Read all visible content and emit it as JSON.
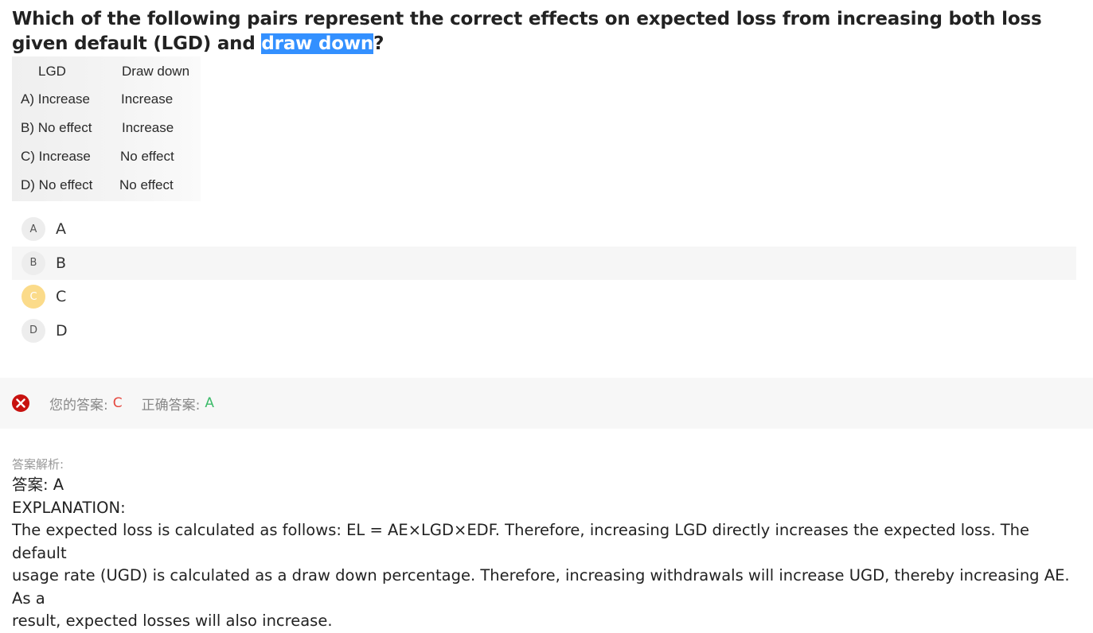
{
  "question": {
    "text_before": "Which of the following pairs represent the correct effects on expected loss from increasing both loss given default (LGD) and ",
    "highlight": "draw down",
    "text_after": "?"
  },
  "table": {
    "header": {
      "lgd": "LGD",
      "draw_down": "Draw down"
    },
    "rows": [
      {
        "lgd": "A) Increase",
        "draw_down": "Increase"
      },
      {
        "lgd": "B) No effect",
        "draw_down": "Increase"
      },
      {
        "lgd": "C) Increase",
        "draw_down": "No effect"
      },
      {
        "lgd": "D) No effect",
        "draw_down": "No effect"
      }
    ]
  },
  "options": [
    {
      "letter": "A",
      "label": "A"
    },
    {
      "letter": "B",
      "label": "B"
    },
    {
      "letter": "C",
      "label": "C"
    },
    {
      "letter": "D",
      "label": "D"
    }
  ],
  "result": {
    "your_answer_label": "您的答案:",
    "your_answer": "C",
    "correct_answer_label": "正确答案:",
    "correct_answer": "A"
  },
  "analysis": {
    "label": "答案解析:",
    "answer_line": "答案: A",
    "explanation_title": "EXPLANATION:",
    "explanation_lines": [
      "The expected loss is calculated as follows: EL = AE×LGD×EDF. Therefore, increasing LGD directly increases the expected loss. The default",
      "usage rate (UGD) is calculated as a draw down percentage. Therefore, increasing withdrawals will increase UGD, thereby increasing AE. As a",
      "result, expected losses will also increase."
    ]
  },
  "colors": {
    "highlight": "#3390ff",
    "selected_badge": "#fbdb8a",
    "wrong": "#e5483f",
    "right": "#3dbb6a",
    "error_icon": "#c8120f"
  }
}
